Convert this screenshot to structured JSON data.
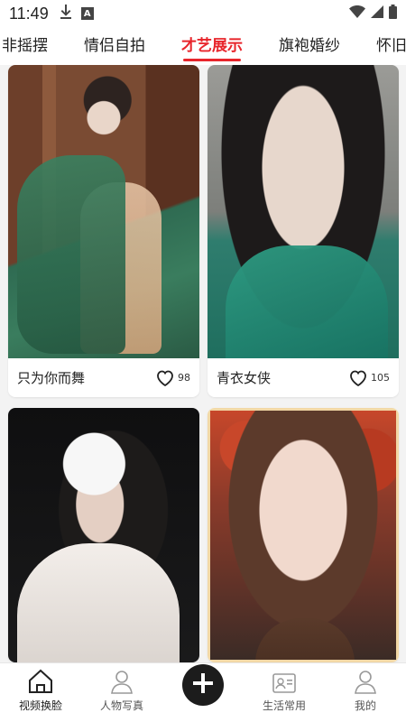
{
  "status_bar": {
    "time": "11:49",
    "indicator_letter": "A"
  },
  "tabs": [
    {
      "label": "非摇摆",
      "active": false
    },
    {
      "label": "情侣自拍",
      "active": false
    },
    {
      "label": "才艺展示",
      "active": true
    },
    {
      "label": "旗袍婚纱",
      "active": false
    },
    {
      "label": "怀旧经",
      "active": false
    }
  ],
  "grid": {
    "cards": [
      {
        "title": "只为你而舞",
        "likes": "98"
      },
      {
        "title": "青衣女侠",
        "likes": "105"
      },
      {
        "title": "",
        "likes": ""
      },
      {
        "title": "",
        "likes": ""
      }
    ]
  },
  "bottom_nav": {
    "items": [
      {
        "label": "视频换脸",
        "icon": "home-icon"
      },
      {
        "label": "人物写真",
        "icon": "portrait-icon"
      },
      {
        "label": "",
        "icon": "plus-icon"
      },
      {
        "label": "生活常用",
        "icon": "id-card-icon"
      },
      {
        "label": "我的",
        "icon": "user-icon"
      }
    ]
  },
  "colors": {
    "accent": "#e8252b",
    "fab": "#1c1c1c"
  }
}
